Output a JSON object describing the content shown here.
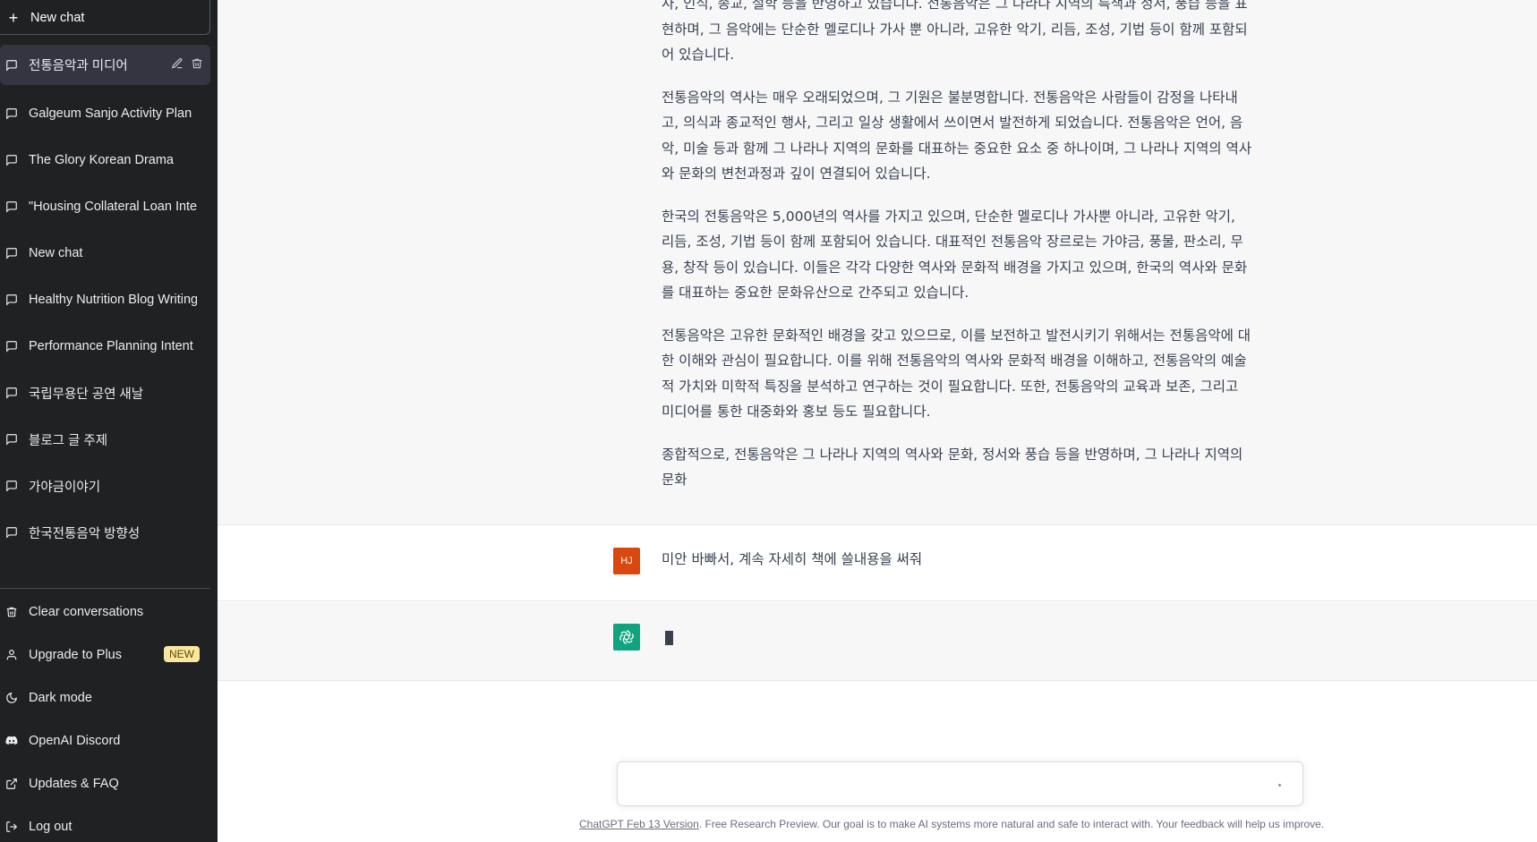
{
  "sidebar": {
    "new_chat_label": "New chat",
    "conversations": [
      {
        "label": "전통음악과 미디어",
        "active": true
      },
      {
        "label": "Galgeum Sanjo Activity Plan"
      },
      {
        "label": "The Glory Korean Drama"
      },
      {
        "label": "\"Housing Collateral Loan Interest"
      },
      {
        "label": "New chat"
      },
      {
        "label": "Healthy Nutrition Blog Writing"
      },
      {
        "label": "Performance Planning Intent"
      },
      {
        "label": "국립무용단 공연 새날"
      },
      {
        "label": "블로그 글 주제"
      },
      {
        "label": "가야금이야기"
      },
      {
        "label": "한국전통음악 방향성"
      }
    ],
    "menu": {
      "clear": "Clear conversations",
      "upgrade": "Upgrade to Plus",
      "upgrade_badge": "NEW",
      "dark": "Dark mode",
      "discord": "OpenAI Discord",
      "updates": "Updates & FAQ",
      "logout": "Log out"
    }
  },
  "thread": {
    "ai_paragraphs": [
      "사, 인식, 종교, 철학 등을 반영하고 있습니다. 전통음악은 그 나라나 지역의 특색과 정서, 풍습 등을 표현하며, 그 음악에는 단순한 멜로디나 가사 뿐 아니라, 고유한 악기, 리듬, 조성, 기법 등이 함께 포함되어 있습니다.",
      "전통음악의 역사는 매우 오래되었으며, 그 기원은 불분명합니다. 전통음악은 사람들이 감정을 나타내고, 의식과 종교적인 행사, 그리고 일상 생활에서 쓰이면서 발전하게 되었습니다. 전통음악은 언어, 음악, 미술 등과 함께 그 나라나 지역의 문화를 대표하는 중요한 요소 중 하나이며, 그 나라나 지역의 역사와 문화의 변천과정과 깊이 연결되어 있습니다.",
      "한국의 전통음악은 5,000년의 역사를 가지고 있으며, 단순한 멜로디나 가사뿐 아니라, 고유한 악기, 리듬, 조성, 기법 등이 함께 포함되어 있습니다. 대표적인 전통음악 장르로는 가야금, 풍물, 판소리, 무용, 창작 등이 있습니다. 이들은 각각 다양한 역사와 문화적 배경을 가지고 있으며, 한국의 역사와 문화를 대표하는 중요한 문화유산으로 간주되고 있습니다.",
      "전통음악은 고유한 문화적인 배경을 갖고 있으므로, 이를 보전하고 발전시키기 위해서는 전통음악에 대한 이해와 관심이 필요합니다. 이를 위해 전통음악의 역사와 문화적 배경을 이해하고, 전통음악의 예술적 가치와 미학적 특징을 분석하고 연구하는 것이 필요합니다. 또한, 전통음악의 교육과 보존, 그리고 미디어를 통한 대중화와 홍보 등도 필요합니다.",
      "종합적으로, 전통음악은 그 나라나 지역의 역사와 문화, 정서와 풍습 등을 반영하며, 그 나라나 지역의 문화"
    ],
    "user_initials": "HJ",
    "user_message": "미안 바빠서, 계속 자세히 책에 쓸내용을 써줘"
  },
  "input": {
    "placeholder": ""
  },
  "footer": {
    "link": "ChatGPT Feb 13 Version",
    "text": ". Free Research Preview. Our goal is to make AI systems more natural and safe to interact with. Your feedback will help us improve."
  },
  "colors": {
    "sidebar_bg": "#202123",
    "accent": "#10a37f",
    "user_avatar": "#d9480f",
    "badge": "#fae69e"
  }
}
